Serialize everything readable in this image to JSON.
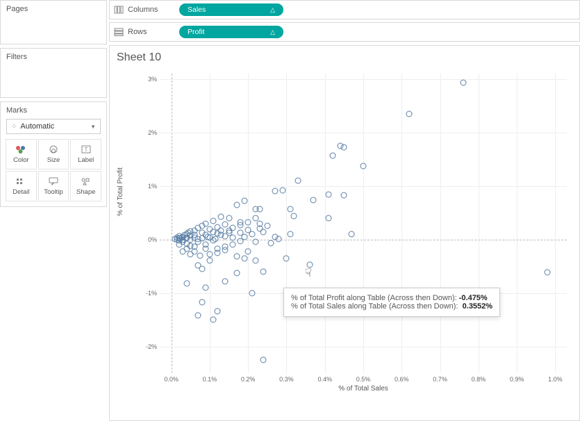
{
  "left": {
    "pages_label": "Pages",
    "filters_label": "Filters",
    "marks_label": "Marks",
    "mark_type": "Automatic",
    "mark_type_prefix": "⁘",
    "cells": [
      "Color",
      "Size",
      "Label",
      "Detail",
      "Tooltip",
      "Shape"
    ]
  },
  "shelves": {
    "columns_label": "Columns",
    "rows_label": "Rows",
    "columns_pill": "Sales",
    "rows_pill": "Profit",
    "triangle": "△"
  },
  "sheet_title": "Sheet 10",
  "tooltip": {
    "line1_label": "% of Total Profit along Table (Across then Down):",
    "line1_value": "-0.475%",
    "line2_label": "% of Total Sales along Table (Across then Down):",
    "line2_value": "0.3552%"
  },
  "chart_data": {
    "type": "scatter",
    "xlabel": "% of Total Sales",
    "ylabel": "% of Total Profit",
    "xlim": [
      -0.03,
      1.03
    ],
    "ylim": [
      -2.5,
      3.1
    ],
    "x_ticks": [
      "0.0%",
      "0.1%",
      "0.2%",
      "0.3%",
      "0.4%",
      "0.5%",
      "0.6%",
      "0.7%",
      "0.8%",
      "0.9%",
      "1.0%"
    ],
    "y_ticks": [
      "-2%",
      "-1%",
      "0%",
      "1%",
      "2%",
      "3%"
    ],
    "y_tick_vals": [
      -2,
      -1,
      0,
      1,
      2,
      3
    ],
    "x_tick_vals": [
      0,
      0.1,
      0.2,
      0.3,
      0.4,
      0.5,
      0.6,
      0.7,
      0.8,
      0.9,
      1.0
    ],
    "hovered": {
      "x": 0.3552,
      "y": -0.475
    },
    "points": [
      [
        0.76,
        2.93
      ],
      [
        0.62,
        2.35
      ],
      [
        0.44,
        1.75
      ],
      [
        0.45,
        1.72
      ],
      [
        0.42,
        1.57
      ],
      [
        0.5,
        1.37
      ],
      [
        0.33,
        1.1
      ],
      [
        0.29,
        0.92
      ],
      [
        0.27,
        0.9
      ],
      [
        0.41,
        0.84
      ],
      [
        0.45,
        0.83
      ],
      [
        0.37,
        0.74
      ],
      [
        0.19,
        0.72
      ],
      [
        0.17,
        0.65
      ],
      [
        0.22,
        0.57
      ],
      [
        0.23,
        0.56
      ],
      [
        0.31,
        0.57
      ],
      [
        0.32,
        0.43
      ],
      [
        0.41,
        0.4
      ],
      [
        0.13,
        0.42
      ],
      [
        0.22,
        0.4
      ],
      [
        0.15,
        0.4
      ],
      [
        0.11,
        0.34
      ],
      [
        0.09,
        0.3
      ],
      [
        0.2,
        0.32
      ],
      [
        0.18,
        0.27
      ],
      [
        0.25,
        0.25
      ],
      [
        0.23,
        0.2
      ],
      [
        0.14,
        0.28
      ],
      [
        0.23,
        0.3
      ],
      [
        0.08,
        0.25
      ],
      [
        0.07,
        0.22
      ],
      [
        0.12,
        0.23
      ],
      [
        0.1,
        0.19
      ],
      [
        0.06,
        0.17
      ],
      [
        0.05,
        0.15
      ],
      [
        0.11,
        0.14
      ],
      [
        0.15,
        0.12
      ],
      [
        0.18,
        0.12
      ],
      [
        0.04,
        0.1
      ],
      [
        0.09,
        0.08
      ],
      [
        0.14,
        0.06
      ],
      [
        0.47,
        0.1
      ],
      [
        0.03,
        0.05
      ],
      [
        0.06,
        0.03
      ],
      [
        0.08,
        0.02
      ],
      [
        0.02,
        0.02
      ],
      [
        0.05,
        -0.01
      ],
      [
        0.31,
        0.1
      ],
      [
        0.11,
        -0.02
      ],
      [
        0.07,
        -0.05
      ],
      [
        0.04,
        -0.08
      ],
      [
        0.09,
        -0.1
      ],
      [
        0.14,
        -0.13
      ],
      [
        0.12,
        -0.17
      ],
      [
        0.2,
        -0.22
      ],
      [
        0.22,
        -0.05
      ],
      [
        0.26,
        -0.07
      ],
      [
        0.18,
        -0.03
      ],
      [
        0.28,
        0.01
      ],
      [
        0.03,
        -0.22
      ],
      [
        0.05,
        -0.28
      ],
      [
        0.17,
        -0.32
      ],
      [
        0.19,
        -0.35
      ],
      [
        0.3,
        -0.35
      ],
      [
        0.1,
        -0.4
      ],
      [
        0.22,
        -0.4
      ],
      [
        0.07,
        -0.48
      ],
      [
        0.08,
        -0.55
      ],
      [
        0.17,
        -0.63
      ],
      [
        0.24,
        -0.6
      ],
      [
        0.14,
        -0.78
      ],
      [
        0.04,
        -0.82
      ],
      [
        0.09,
        -0.9
      ],
      [
        0.21,
        -1.0
      ],
      [
        0.08,
        -1.18
      ],
      [
        0.12,
        -1.35
      ],
      [
        0.07,
        -1.42
      ],
      [
        0.11,
        -1.5
      ],
      [
        0.24,
        -2.25
      ],
      [
        0.98,
        -0.62
      ],
      [
        0.36,
        -0.475
      ],
      [
        0.37,
        -1.1
      ],
      [
        0.19,
        0.05
      ],
      [
        0.02,
        -0.02
      ],
      [
        0.015,
        0.03
      ],
      [
        0.035,
        0.08
      ],
      [
        0.045,
        0.12
      ],
      [
        0.02,
        0.06
      ],
      [
        0.06,
        0.09
      ],
      [
        0.13,
        0.08
      ],
      [
        0.15,
        0.17
      ],
      [
        0.16,
        0.04
      ],
      [
        0.1,
        0.03
      ],
      [
        0.08,
        0.13
      ],
      [
        0.05,
        0.07
      ],
      [
        0.12,
        0.11
      ],
      [
        0.115,
        0.01
      ],
      [
        0.07,
        0.01
      ],
      [
        0.095,
        0.05
      ],
      [
        0.13,
        0.17
      ],
      [
        0.04,
        0.04
      ],
      [
        0.16,
        0.22
      ],
      [
        0.2,
        0.18
      ],
      [
        0.24,
        0.14
      ],
      [
        0.27,
        0.05
      ],
      [
        0.21,
        0.1
      ],
      [
        0.18,
        0.32
      ],
      [
        0.03,
        -0.05
      ],
      [
        0.05,
        -0.12
      ],
      [
        0.02,
        -0.1
      ],
      [
        0.09,
        -0.18
      ],
      [
        0.12,
        -0.25
      ],
      [
        0.06,
        -0.14
      ],
      [
        0.01,
        0.01
      ],
      [
        0.015,
        -0.01
      ],
      [
        0.022,
        0.015
      ],
      [
        0.03,
        -0.01
      ],
      [
        0.038,
        0.02
      ],
      [
        0.028,
        0.04
      ],
      [
        0.04,
        -0.18
      ],
      [
        0.06,
        -0.22
      ],
      [
        0.075,
        -0.3
      ],
      [
        0.1,
        -0.28
      ],
      [
        0.14,
        -0.2
      ],
      [
        0.16,
        -0.1
      ]
    ]
  }
}
